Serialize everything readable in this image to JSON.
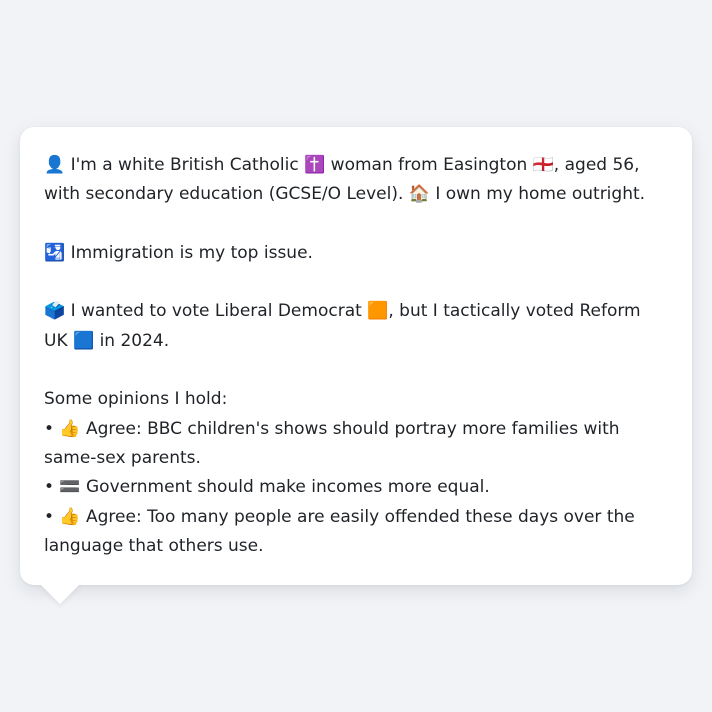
{
  "profile": {
    "intro": "👤 I'm a white British Catholic ✝️ woman from Easington 🏴󠁧󠁢󠁥󠁮󠁧󠁿, aged 56, with secondary education (GCSE/O Level). 🏠 I own my home outright.",
    "top_issue": "🛂 Immigration is my top issue.",
    "vote": "🗳️ I wanted to vote Liberal Democrat 🟧, but I tactically voted Reform UK 🟦 in 2024.",
    "opinions_heading": "Some opinions I hold:",
    "opinions": [
      "• 👍 Agree: BBC children's shows should portray more families with same-sex parents.",
      "• 🟰 Government should make incomes more equal.",
      "• 👍 Agree: Too many people are easily offended these days over the language that others use."
    ]
  }
}
